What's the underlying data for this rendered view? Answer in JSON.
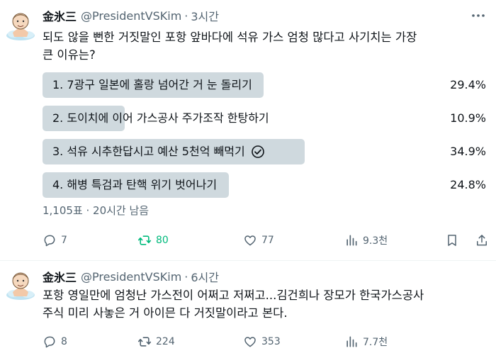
{
  "tweets": [
    {
      "author_name": "金氷三",
      "handle": "@PresidentVSKim",
      "separator": "·",
      "time": "3시간",
      "text_lines": [
        "되도 않을 뻔한 거짓말인 포항 앞바다에 석유 가스 엄청 많다고 사기치는 가장",
        "큰 이유는?"
      ],
      "poll": {
        "options": [
          {
            "label": "1. 7광구 일본에 홀랑 넘어간 거 눈 돌리기",
            "percent_text": "29.4%",
            "percent": 29.4,
            "selected": false
          },
          {
            "label": "2. 도이치에 이어 가스공사 주가조작 한탕하기",
            "percent_text": "10.9%",
            "percent": 10.9,
            "selected": false
          },
          {
            "label": "3. 석유 시추한답시고 예산 5천억 빼먹기",
            "percent_text": "34.9%",
            "percent": 34.9,
            "selected": true
          },
          {
            "label": "4. 해병 특검과 탄핵 위기 벗어나기",
            "percent_text": "24.8%",
            "percent": 24.8,
            "selected": false
          }
        ],
        "meta": "1,105표 · 20시간 남음"
      },
      "actions": {
        "replies": "7",
        "retweets": "80",
        "likes": "77",
        "views": "9.3천"
      },
      "retweeted": true
    },
    {
      "author_name": "金氷三",
      "handle": "@PresidentVSKim",
      "separator": "·",
      "time": "6시간",
      "text_lines": [
        "포항 영일만에 엄청난 가스전이 어쩌고 저쩌고...김건희나 장모가 한국가스공사",
        "주식 미리 사놓은 거 아이믄 다 거짓말이라고 본다."
      ],
      "actions": {
        "replies": "8",
        "retweets": "224",
        "likes": "353",
        "views": "7.7천"
      },
      "retweeted": false
    }
  ],
  "colors": {
    "text": "#0f1419",
    "secondary": "#536471",
    "poll_bar": "#cfd9de",
    "retweet_active": "#00ba7c",
    "divider": "#eff3f4"
  },
  "icons": [
    "avatar-illustration",
    "more-icon",
    "reply-icon",
    "retweet-icon",
    "like-icon",
    "views-icon",
    "bookmark-icon",
    "share-icon",
    "check-circle-icon"
  ]
}
